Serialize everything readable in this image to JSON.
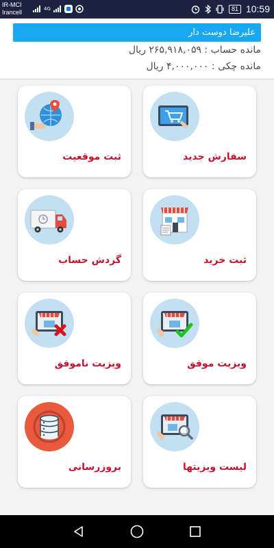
{
  "status_bar": {
    "carrier_line1": "IR-MCI",
    "carrier_line2": "Irancell",
    "network": "4G",
    "battery": "81",
    "time": "10:59"
  },
  "header": {
    "user_name": "علیرضا دوست دار",
    "account_balance": "مانده حساب : ۲۶۵,۹۱۸,۰۵۹ ریال",
    "cheque_balance": "مانده چکی : ۴,۰۰۰,۰۰۰ ریال"
  },
  "menu": [
    {
      "label": "سفارش جدید",
      "icon": "cart-icon"
    },
    {
      "label": "ثبت موقعیت",
      "icon": "location-icon"
    },
    {
      "label": "ثبت خرید",
      "icon": "store-icon"
    },
    {
      "label": "گردش حساب",
      "icon": "truck-icon"
    },
    {
      "label": "ویزیت موفق",
      "icon": "visit-success-icon"
    },
    {
      "label": "ویزیت ناموفق",
      "icon": "visit-failed-icon"
    },
    {
      "label": "لیست ویزیتها",
      "icon": "visit-list-icon"
    },
    {
      "label": "بروزرسانی",
      "icon": "database-sync-icon"
    }
  ],
  "colors": {
    "accent": "#1aa8f4",
    "label": "#c4122f",
    "status_bar": "#1c2240"
  }
}
